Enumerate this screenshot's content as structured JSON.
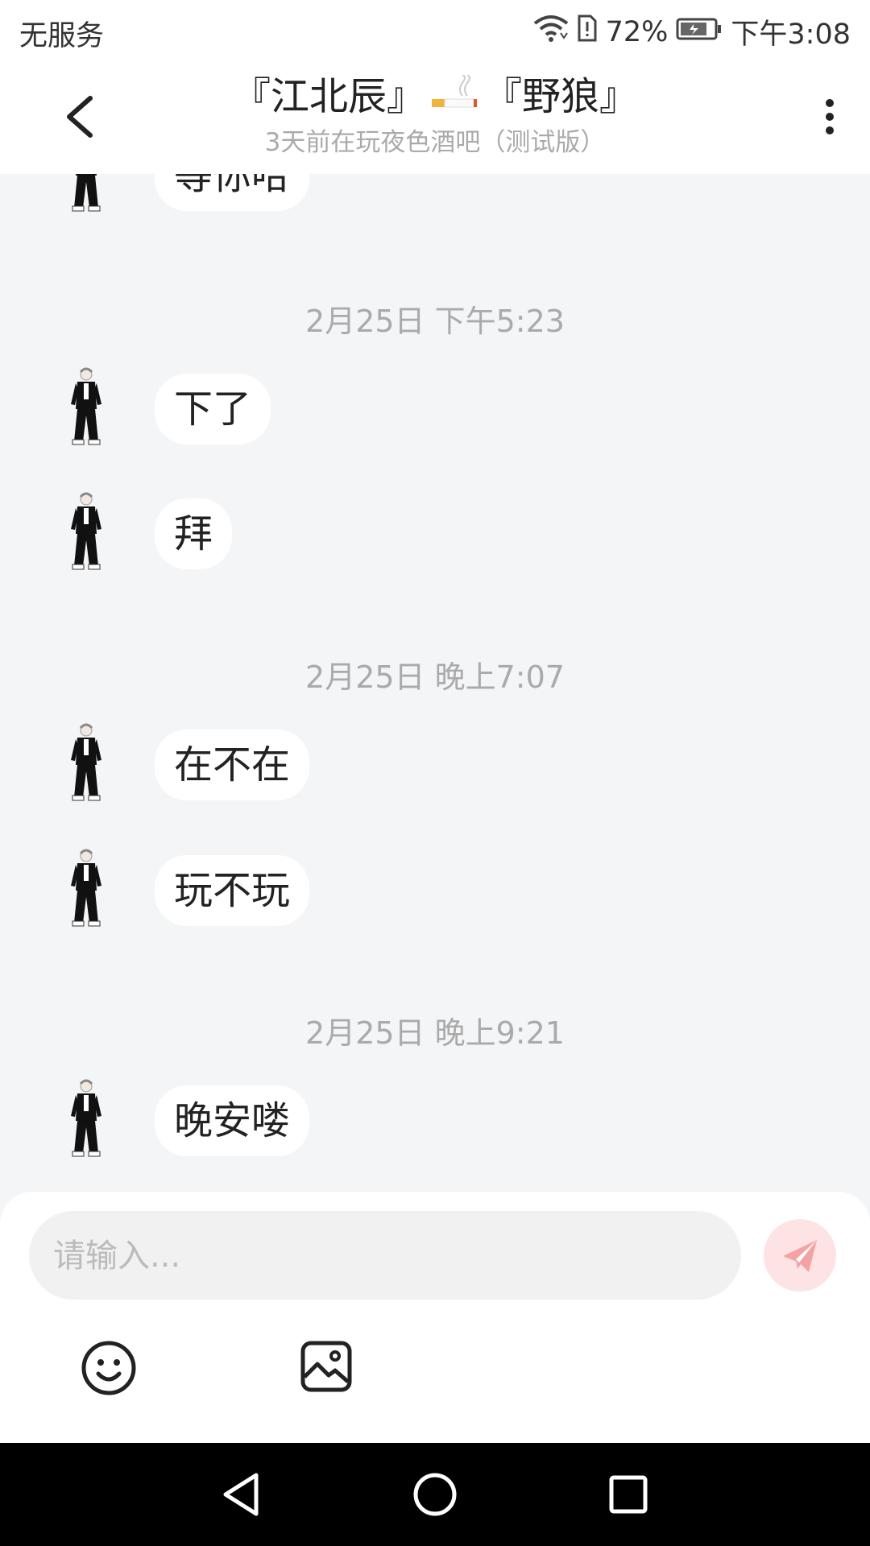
{
  "status_bar": {
    "carrier": "无服务",
    "battery_percent": "72%",
    "time": "下午3:08",
    "icons": [
      "wifi-icon",
      "sim-alert-icon",
      "battery-icon"
    ]
  },
  "header": {
    "title_left": "『江北辰』",
    "title_right": "『野狼』",
    "title_emoji": "cigarette-icon",
    "subtitle": "3天前在玩夜色酒吧（测试版）"
  },
  "messages": [
    {
      "type": "text",
      "text": "等你哈"
    },
    {
      "type": "time",
      "text": "2月25日 下午5:23"
    },
    {
      "type": "text",
      "text": "下了"
    },
    {
      "type": "text",
      "text": "拜"
    },
    {
      "type": "time",
      "text": "2月25日 晚上7:07"
    },
    {
      "type": "text",
      "text": "在不在"
    },
    {
      "type": "text",
      "text": "玩不玩"
    },
    {
      "type": "time",
      "text": "2月25日 晚上9:21"
    },
    {
      "type": "text",
      "text": "晚安喽"
    }
  ],
  "input": {
    "placeholder": "请输入...",
    "value": ""
  },
  "colors": {
    "background": "#f4f5f7",
    "bubble": "#ffffff",
    "send_button": "#fde3e3",
    "send_icon": "#f3a3a3"
  }
}
